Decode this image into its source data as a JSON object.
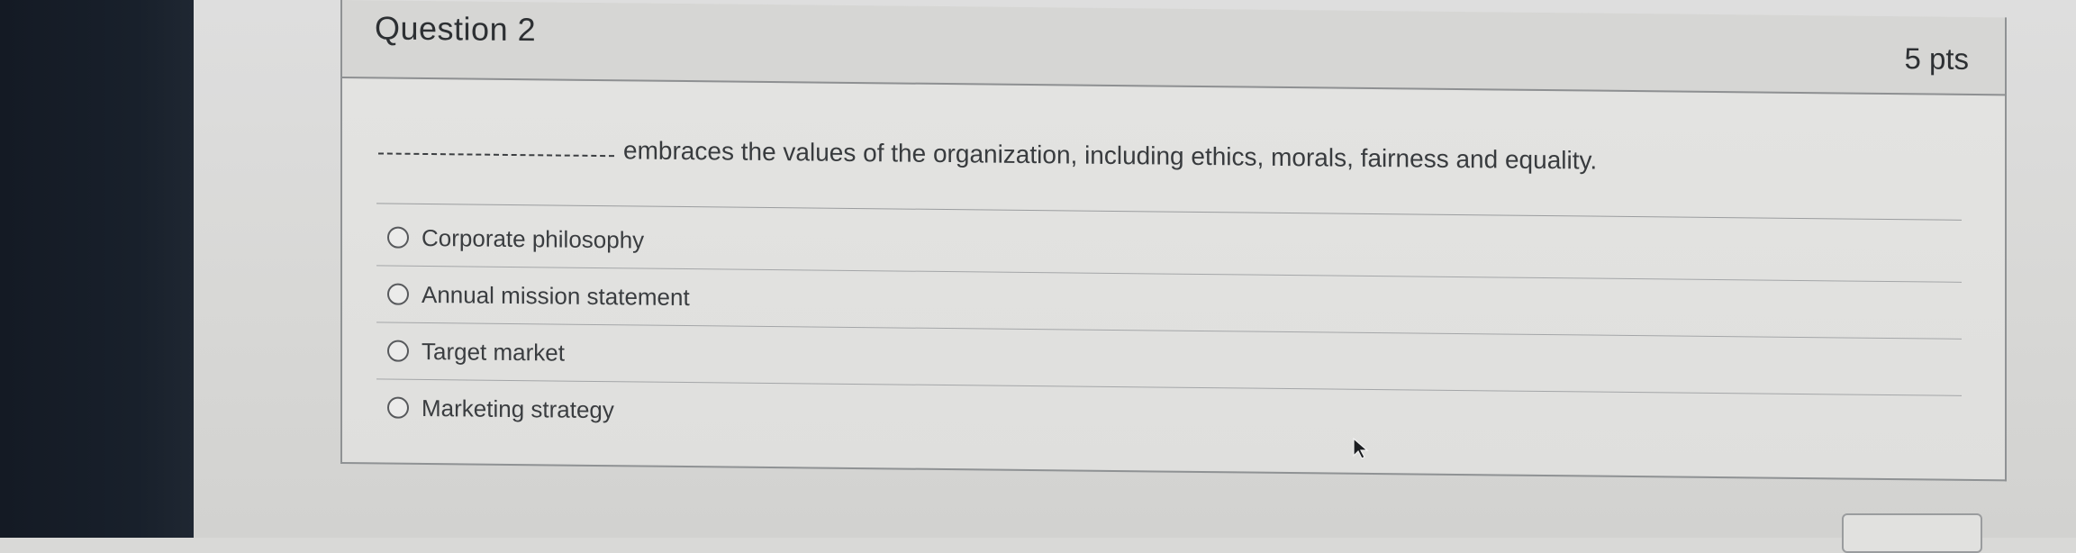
{
  "question": {
    "title": "Question 2",
    "points": "5 pts",
    "prompt": "embraces the values of the organization, including ethics, morals, fairness and equality."
  },
  "answers": [
    {
      "label": "Corporate philosophy",
      "selected": false
    },
    {
      "label": "Annual mission statement",
      "selected": false
    },
    {
      "label": "Target market",
      "selected": false
    },
    {
      "label": "Marketing strategy",
      "selected": false
    }
  ],
  "icons": {
    "cursor": "mouse-pointer-icon",
    "radio": "radio-button-icon"
  },
  "colors": {
    "bezel": "#151b25",
    "screen_background": "#dcdcda",
    "card_border": "#8f9294",
    "text": "#2d3033"
  }
}
